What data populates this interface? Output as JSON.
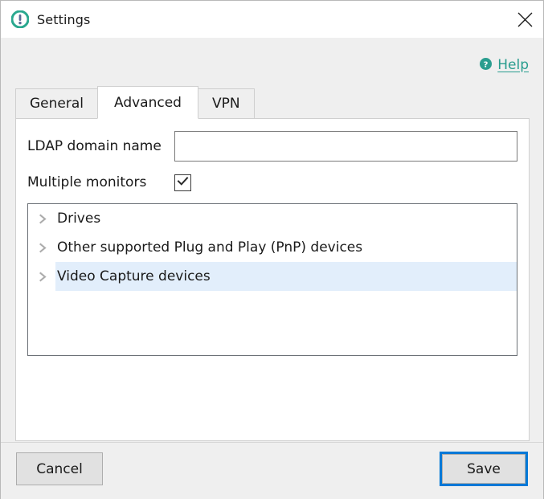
{
  "window": {
    "title": "Settings",
    "app_icon": "exclamation-circle-icon",
    "close_label": "✕"
  },
  "help": {
    "icon": "question-mark-circle-icon",
    "label": "Help",
    "color": "#2a9d8f"
  },
  "tabs": [
    {
      "label": "General",
      "active": false
    },
    {
      "label": "Advanced",
      "active": true
    },
    {
      "label": "VPN",
      "active": false
    }
  ],
  "form": {
    "ldap": {
      "label": "LDAP domain name",
      "value": "",
      "placeholder": ""
    },
    "multiple_monitors": {
      "label": "Multiple monitors",
      "checked": true,
      "check_glyph": "✓"
    }
  },
  "device_list": {
    "items": [
      {
        "label": "Drives",
        "expander": "chevron-right-icon",
        "selected": false
      },
      {
        "label": "Other supported Plug and Play (PnP) devices",
        "expander": "chevron-right-icon",
        "selected": false
      },
      {
        "label": "Video Capture devices",
        "expander": "chevron-right-icon",
        "selected": true
      }
    ],
    "selection_color": "#e2eefb"
  },
  "footer": {
    "cancel_label": "Cancel",
    "save_label": "Save",
    "focus_color": "#0078d7"
  }
}
